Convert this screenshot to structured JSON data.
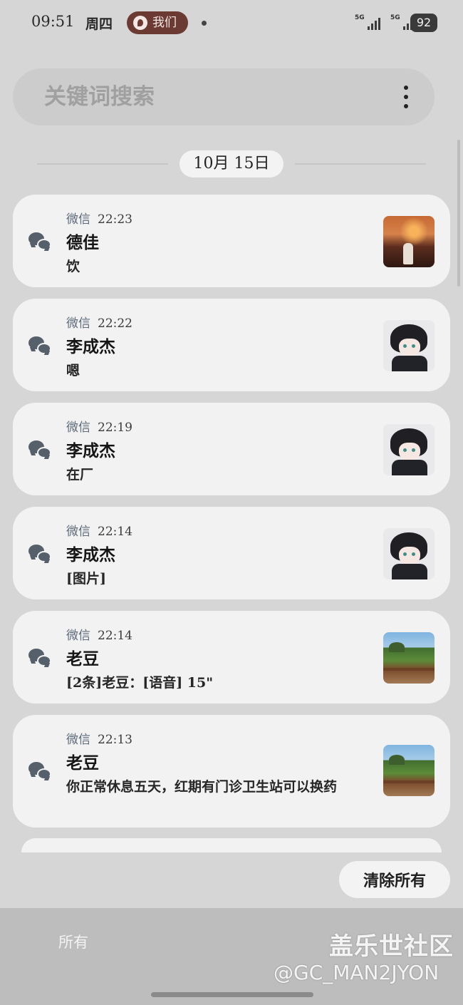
{
  "status_bar": {
    "time": "09:51",
    "day": "周四",
    "pill_text": "我们",
    "signal_1": "5G",
    "signal_2": "5G",
    "battery": "92"
  },
  "search": {
    "placeholder": "关键词搜索"
  },
  "date_header": "10月 15日",
  "notifications": [
    {
      "app": "微信",
      "time": "22:23",
      "sender": "德佳",
      "message": "饮",
      "thumb": "sunset-photo"
    },
    {
      "app": "微信",
      "time": "22:22",
      "sender": "李成杰",
      "message": "嗯",
      "thumb": "anime-avatar"
    },
    {
      "app": "微信",
      "time": "22:19",
      "sender": "李成杰",
      "message": "在厂",
      "thumb": "anime-avatar"
    },
    {
      "app": "微信",
      "time": "22:14",
      "sender": "李成杰",
      "message": "[图片]",
      "thumb": "anime-avatar"
    },
    {
      "app": "微信",
      "time": "22:14",
      "sender": "老豆",
      "message": "[2条]老豆：[语音] 15\"",
      "thumb": "landscape-photo"
    },
    {
      "app": "微信",
      "time": "22:13",
      "sender": "老豆",
      "message": "你正常休息五天，红期有门诊卫生站可以换药",
      "thumb": "landscape-photo"
    }
  ],
  "clear_all_label": "清除所有",
  "bottom_tab": {
    "all_label": "所有"
  },
  "watermark": {
    "line1": "盖乐世社区",
    "line2": "@GC_MAN2JYON"
  },
  "colors": {
    "background": "#d6d6d6",
    "card": "#f2f2f2",
    "pill": "#6b3a32",
    "app_label": "#5d6a7a"
  },
  "icons": {
    "app": "wechat-icon",
    "menu": "more-vertical-icon"
  }
}
